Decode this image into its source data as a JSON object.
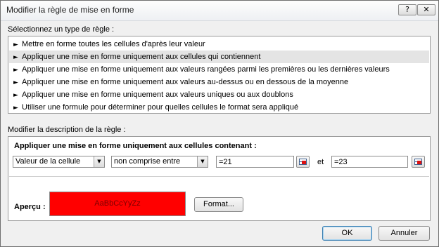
{
  "window": {
    "title": "Modifier la règle de mise en forme",
    "help_glyph": "?",
    "close_glyph": "✕"
  },
  "rule_types": {
    "label": "Sélectionnez un type de règle :",
    "items": [
      "Mettre en forme toutes les cellules d'après leur valeur",
      "Appliquer une mise en forme uniquement aux cellules qui contiennent",
      "Appliquer une mise en forme uniquement aux valeurs rangées parmi les premières ou les dernières valeurs",
      "Appliquer une mise en forme uniquement aux valeurs au-dessus ou en dessous de la moyenne",
      "Appliquer une mise en forme uniquement aux valeurs uniques ou aux doublons",
      "Utiliser une formule pour déterminer pour quelles cellules le format sera appliqué"
    ],
    "selected_index": 1,
    "bullet": "►"
  },
  "description": {
    "label": "Modifier la description de la règle :",
    "heading": "Appliquer une mise en forme uniquement aux cellules contenant :",
    "field_select": "Valeur de la cellule",
    "operator_select": "non comprise entre",
    "value1": "=21",
    "and_label": "et",
    "value2": "=23",
    "preview_label": "Aperçu :",
    "preview_text": "AaBbCcYyZz",
    "format_button": "Format..."
  },
  "footer": {
    "ok": "OK",
    "cancel": "Annuler"
  },
  "colors": {
    "preview_fill": "#ff0000",
    "selected_row": "#e4e4e4"
  }
}
